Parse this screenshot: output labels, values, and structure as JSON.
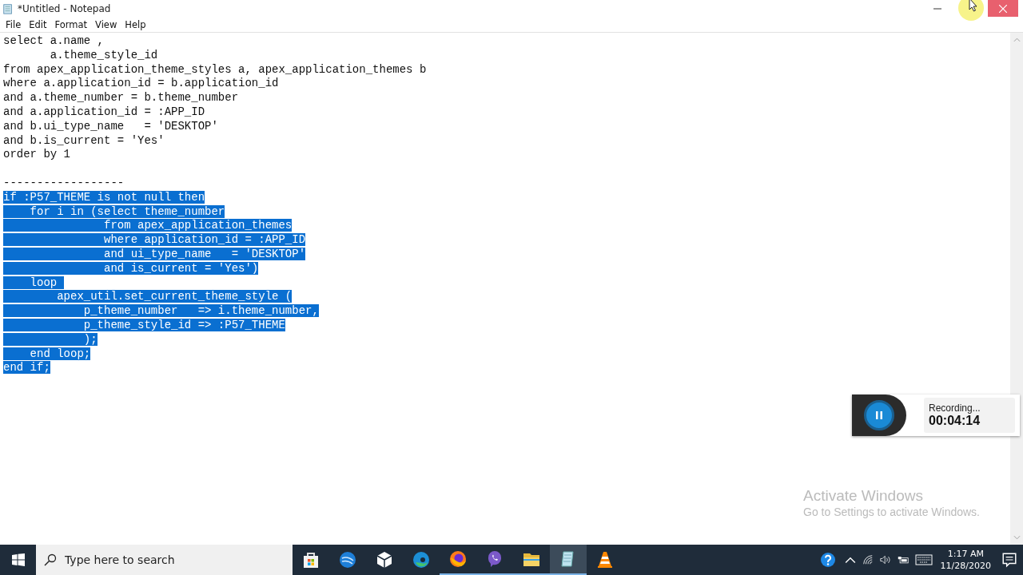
{
  "window": {
    "title": "*Untitled - Notepad"
  },
  "menu": [
    "File",
    "Edit",
    "Format",
    "View",
    "Help"
  ],
  "editor": {
    "lines": [
      {
        "kind": "text",
        "text": "select a.name ,",
        "selected": false
      },
      {
        "kind": "text",
        "text": "       a.theme_style_id",
        "selected": false
      },
      {
        "kind": "text",
        "text": "from apex_application_theme_styles a, apex_application_themes b",
        "selected": false
      },
      {
        "kind": "text",
        "text": "where a.application_id = b.application_id",
        "selected": false
      },
      {
        "kind": "text",
        "text": "and a.theme_number = b.theme_number",
        "selected": false
      },
      {
        "kind": "text",
        "text": "and a.application_id = :APP_ID",
        "selected": false
      },
      {
        "kind": "text",
        "text": "and b.ui_type_name   = 'DESKTOP'",
        "selected": false
      },
      {
        "kind": "text",
        "text": "and b.is_current = 'Yes'",
        "selected": false
      },
      {
        "kind": "text",
        "text": "order by 1",
        "selected": false
      },
      {
        "kind": "blank"
      },
      {
        "kind": "text",
        "text": "------------------",
        "selected": false
      },
      {
        "kind": "text",
        "text": "if :P57_THEME is not null then",
        "selected": true
      },
      {
        "kind": "text",
        "text": "    for i in (select theme_number",
        "selected": true
      },
      {
        "kind": "text",
        "text": "               from apex_application_themes",
        "selected": true
      },
      {
        "kind": "text",
        "text": "               where application_id = :APP_ID",
        "selected": true
      },
      {
        "kind": "text",
        "text": "               and ui_type_name   = 'DESKTOP'",
        "selected": true
      },
      {
        "kind": "text",
        "text": "               and is_current = 'Yes')",
        "selected": true
      },
      {
        "kind": "text",
        "text": "    loop ",
        "selected": true
      },
      {
        "kind": "text",
        "text": "        apex_util.set_current_theme_style (",
        "selected": true
      },
      {
        "kind": "text",
        "text": "            p_theme_number   => i.theme_number,",
        "selected": true
      },
      {
        "kind": "text",
        "text": "            p_theme_style_id => :P57_THEME",
        "selected": true
      },
      {
        "kind": "text",
        "text": "            );",
        "selected": true
      },
      {
        "kind": "text",
        "text": "    end loop;",
        "selected": true
      },
      {
        "kind": "text",
        "text": "end if;",
        "selected": true
      }
    ]
  },
  "recorder": {
    "status": "Recording...",
    "elapsed": "00:04:14"
  },
  "activation": {
    "title": "Activate Windows",
    "message": "Go to Settings to activate Windows."
  },
  "taskbar": {
    "search": {
      "placeholder": "Type here to search"
    },
    "apps": [
      {
        "kind": "store",
        "selected": false,
        "running": false
      },
      {
        "kind": "globe",
        "selected": false,
        "running": false
      },
      {
        "kind": "cube",
        "selected": false,
        "running": false
      },
      {
        "kind": "edge",
        "selected": false,
        "running": false
      },
      {
        "kind": "firefox",
        "selected": false,
        "running": true
      },
      {
        "kind": "viber",
        "selected": false,
        "running": true
      },
      {
        "kind": "folder",
        "selected": false,
        "running": true
      },
      {
        "kind": "notepad",
        "selected": true,
        "running": true
      },
      {
        "kind": "cone",
        "selected": false,
        "running": false
      }
    ],
    "time": "1:17 AM",
    "date": "11/28/2020"
  }
}
